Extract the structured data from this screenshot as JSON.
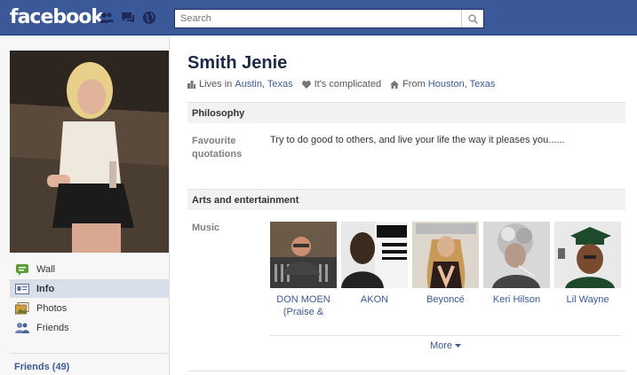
{
  "topbar": {
    "logo": "facebook",
    "search": {
      "placeholder": "Search"
    },
    "icons": [
      "friend-requests-icon",
      "messages-icon",
      "notifications-globe-icon",
      "search-magnifier-icon"
    ]
  },
  "sidebar": {
    "items": [
      {
        "label": "Wall",
        "icon": "wall-icon"
      },
      {
        "label": "Info",
        "icon": "info-icon",
        "active": true
      },
      {
        "label": "Photos",
        "icon": "photos-icon"
      },
      {
        "label": "Friends",
        "icon": "friends-icon"
      }
    ],
    "friends_link": "Friends (49)"
  },
  "profile": {
    "name": "Smith Jenie",
    "lives_prefix": "Lives in",
    "lives_place": "Austin, Texas",
    "relationship": "It's complicated",
    "from_prefix": "From",
    "from_place": "Houston, Texas"
  },
  "sections": {
    "philosophy": {
      "title": "Philosophy",
      "label_line1": "Favourite",
      "label_line2": "quotations",
      "quote": "Try to do good to others, and live your life the way it pleases you......"
    },
    "arts": {
      "title": "Arts and entertainment",
      "music_label": "Music",
      "artists": [
        {
          "line1": "DON MOEN",
          "line2": "(Praise &"
        },
        {
          "line1": "AKON",
          "line2": ""
        },
        {
          "line1": "Beyoncé",
          "line2": ""
        },
        {
          "line1": "Keri Hilson",
          "line2": ""
        },
        {
          "line1": "Lil Wayne",
          "line2": ""
        }
      ],
      "more": "More"
    }
  },
  "colors": {
    "brand": "#3b5998",
    "active_nav": "#d8dfea"
  }
}
